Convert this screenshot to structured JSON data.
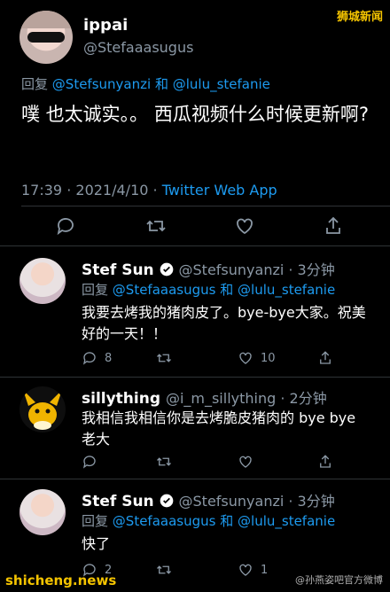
{
  "watermark": {
    "top_right": "狮城新闻",
    "bottom_left": "shicheng.news",
    "bottom_right": "@孙燕姿吧官方微博"
  },
  "main_tweet": {
    "name": "ippai",
    "handle": "@Stefaaasugus",
    "replying_prefix": "回复",
    "replying_user1": "@Stefsunyanzi",
    "replying_and": "和",
    "replying_user2": "@lulu_stefanie",
    "text": "噗 也太诚实。。 西瓜视频什么时候更新啊?",
    "time": "17:39",
    "date": "2021/4/10",
    "dot": "·",
    "app": "Twitter Web App",
    "icons": [
      "reply-icon",
      "retweet-icon",
      "like-icon",
      "share-icon"
    ]
  },
  "replies": [
    {
      "name": "Stef Sun",
      "handle": "@Stefsunyanzi · 3分钟",
      "verified": true,
      "replying_prefix": "回复",
      "replying_user1": "@Stefaaasugus",
      "replying_and": "和",
      "replying_user2": "@lulu_stefanie",
      "text": "我要去烤我的猪肉皮了。bye-bye大家。祝美好的一天！！",
      "reply_count": "8",
      "retweet_count": "",
      "like_count": "10"
    },
    {
      "name": "sillything",
      "handle": "@i_m_sillything · 2分钟",
      "verified": false,
      "text": "我相信我相信你是去烤脆皮猪肉的 bye bye 老大",
      "reply_count": "",
      "retweet_count": "",
      "like_count": ""
    },
    {
      "name": "Stef Sun",
      "handle": "@Stefsunyanzi · 3分钟",
      "verified": true,
      "replying_prefix": "回复",
      "replying_user1": "@Stefaaasugus",
      "replying_and": "和",
      "replying_user2": "@lulu_stefanie",
      "text": "快了",
      "reply_count": "2",
      "retweet_count": "",
      "like_count": "1"
    }
  ],
  "colors": {
    "background": "#000000",
    "link": "#1d9bf0",
    "muted": "#8b98a5",
    "divider": "#2f3336",
    "watermark": "#f5c400"
  }
}
